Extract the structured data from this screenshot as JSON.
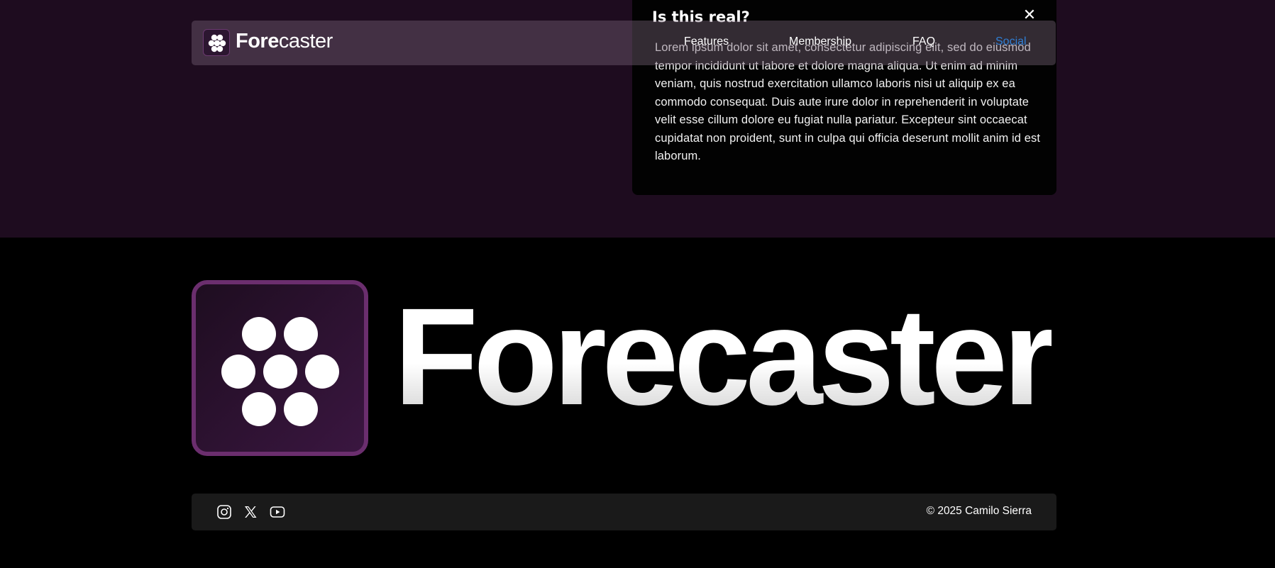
{
  "nav": {
    "brand_bold": "Fore",
    "brand_light": "caster",
    "links": [
      {
        "label": "Features"
      },
      {
        "label": "Membership"
      },
      {
        "label": "FAQ"
      },
      {
        "label": "Social"
      }
    ],
    "active_link": "Social",
    "logo_icon": "dots-logo-icon"
  },
  "faq": {
    "question": "Is this real?",
    "close_icon": "close-icon",
    "answer": "Lorem ipsum dolor sit amet, consectetur adipiscing elit, sed do eiusmod tempor incididunt ut labore et dolore magna aliqua. Ut enim ad minim veniam, quis nostrud exercitation ullamco laboris nisi ut aliquip ex ea commodo consequat. Duis aute irure dolor in reprehenderit in voluptate velit esse cillum dolore eu fugiat nulla pariatur. Excepteur sint occaecat cupidatat non proident, sunt in culpa qui officia deserunt mollit anim id est laborum."
  },
  "hero": {
    "brand": "Forecaster",
    "logo_icon": "dots-logo-icon"
  },
  "footer": {
    "social": [
      "instagram-icon",
      "x-icon",
      "youtube-icon"
    ],
    "copyright": "© 2025 Camilo Sierra"
  },
  "colors": {
    "top_background": "#1e0c1f",
    "page_background": "#000000",
    "accent_link": "#2f7fd6",
    "logo_border": "#6b2e6e",
    "footer_bar": "#1a1a1a"
  }
}
